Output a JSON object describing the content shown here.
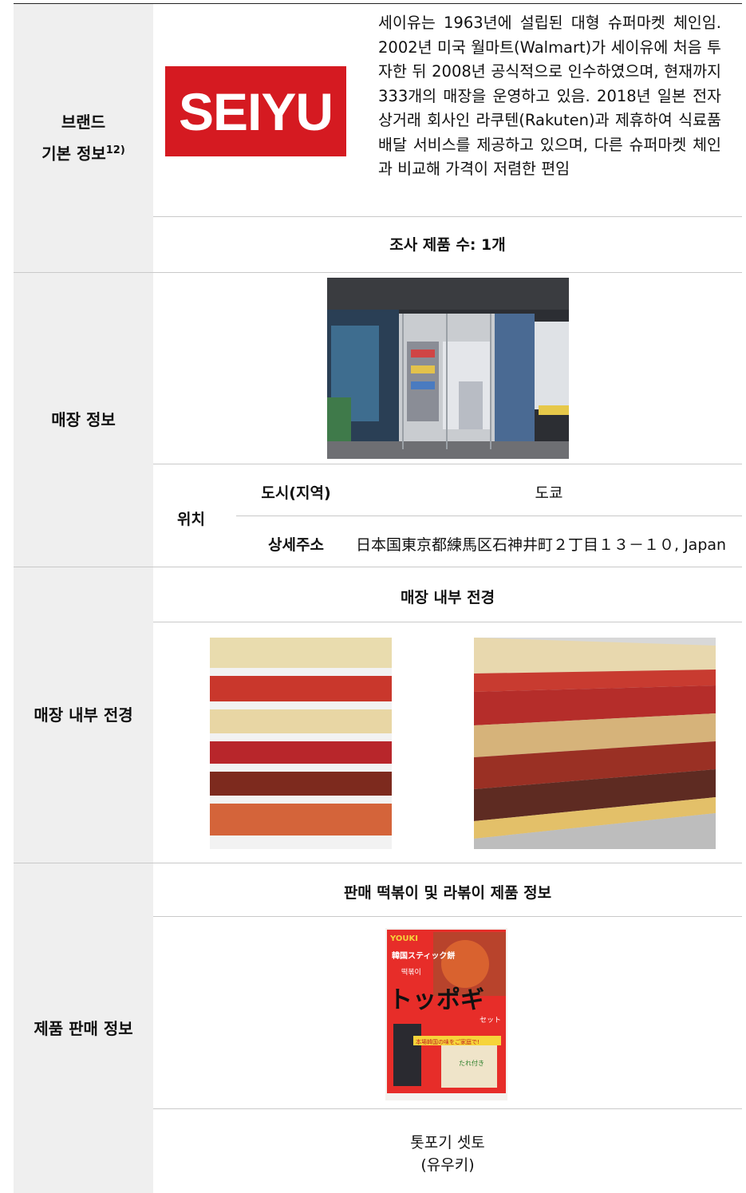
{
  "brand_section": {
    "label_line1": "브랜드",
    "label_line2": "기본 정보",
    "label_footnote": "12)",
    "logo_text": "SEIYU",
    "description": "세이유는 1963년에 설립된 대형 슈퍼마켓 체인임. 2002년 미국 월마트(Walmart)가 세이유에 처음 투자한 뒤 2008년 공식적으로 인수하였으며, 현재까지 333개의 매장을 운영하고 있음. 2018년 일본 전자 상거래 회사인 라쿠텐(Rakuten)과 제휴하여 식료품 배달 서비스를 제공하고 있으며, 다른 슈퍼마켓 체인과 비교해 가격이 저렴한 편임",
    "survey_count": "조사 제품 수: 1개"
  },
  "store_section": {
    "label": "매장 정보",
    "location_label": "위치",
    "city_label": "도시(지역)",
    "city_value": "도쿄",
    "address_label": "상세주소",
    "address_value": "日本国東京都練馬区石神井町２丁目１３－１０, Japan"
  },
  "interior_section": {
    "label": "매장 내부 전경",
    "heading": "매장 내부 전경"
  },
  "product_section": {
    "label": "제품 판매 정보",
    "heading": "판매 떡볶이 및 라볶이 제품 정보",
    "product_name": "톳포기 셋토",
    "product_brand": "(유우키)",
    "package_brand": "YOUKI",
    "package_line1": "韓国スティック餅",
    "package_korean": "떡볶이",
    "package_title": "トッポギ",
    "package_sub": "セット",
    "package_banner": "本場韓国の味をご家庭で!",
    "package_sauce": "たれ付き"
  },
  "colors": {
    "label_bg": "#efefef",
    "brand_red": "#d51a21",
    "separator": "#c9c9c9"
  }
}
